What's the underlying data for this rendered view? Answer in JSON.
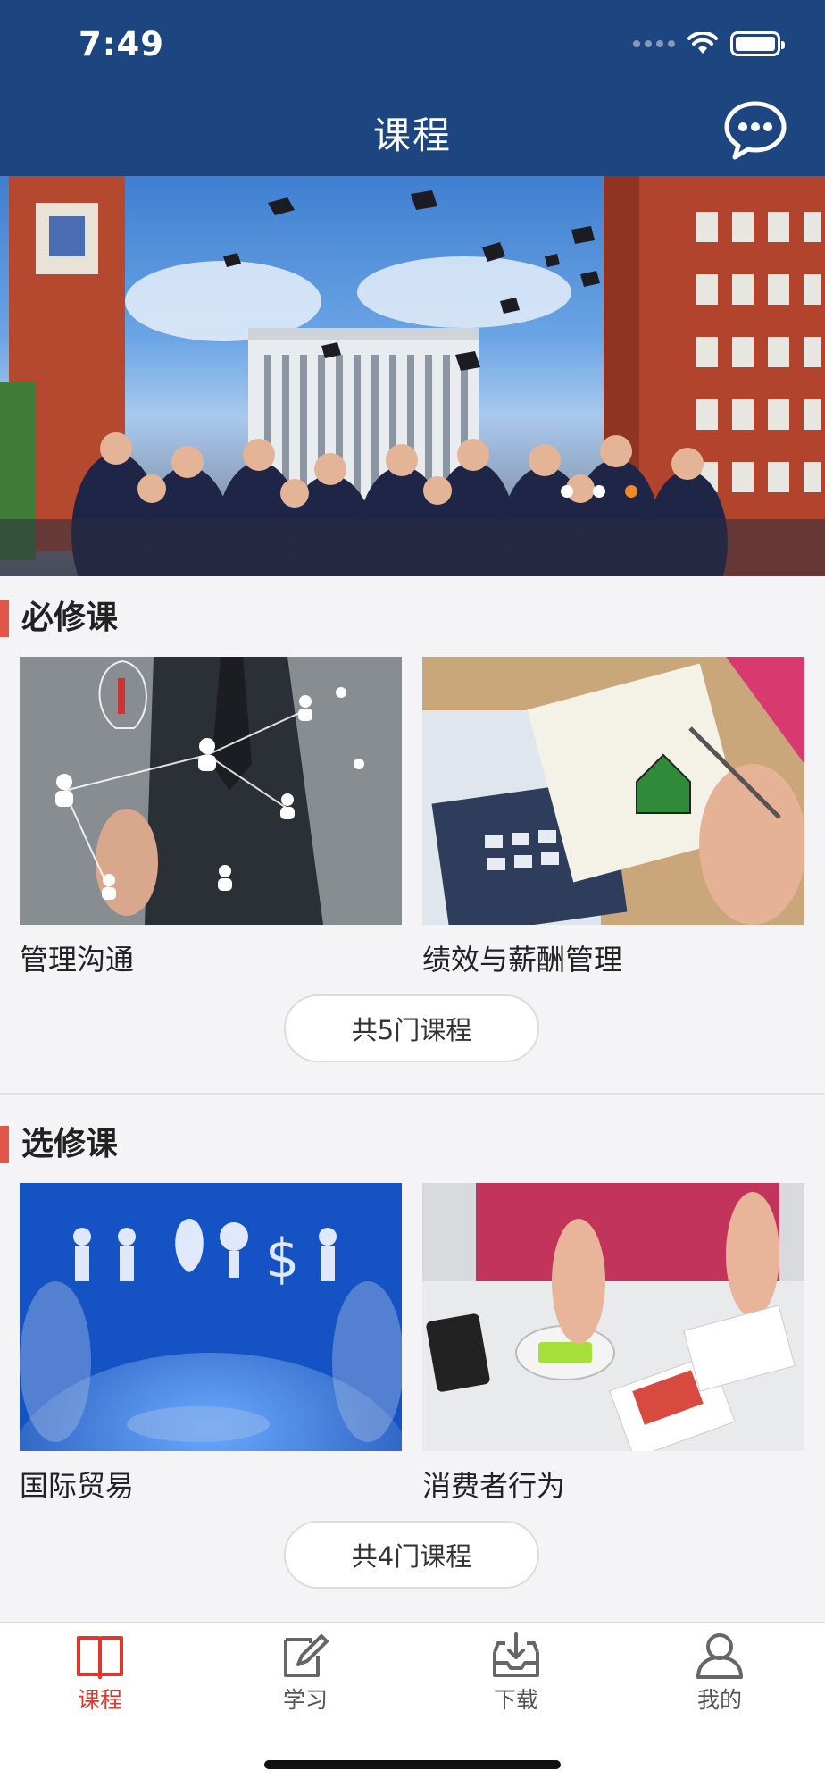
{
  "status_bar": {
    "time": "7:49"
  },
  "header": {
    "title": "课程",
    "chat_icon": "chat-bubble-icon"
  },
  "banner": {
    "dots": 3,
    "active_dot": 2
  },
  "required": {
    "title": "必修课",
    "courses": [
      {
        "name": "管理沟通"
      },
      {
        "name": "绩效与薪酬管理"
      }
    ],
    "more_label": "共5门课程"
  },
  "elective": {
    "title": "选修课",
    "courses": [
      {
        "name": "国际贸易"
      },
      {
        "name": "消费者行为"
      }
    ],
    "more_label": "共4门课程"
  },
  "tabs": [
    {
      "label": "课程",
      "icon": "book-icon",
      "active": true
    },
    {
      "label": "学习",
      "icon": "edit-icon",
      "active": false
    },
    {
      "label": "下载",
      "icon": "download-tray-icon",
      "active": false
    },
    {
      "label": "我的",
      "icon": "user-icon",
      "active": false
    }
  ],
  "colors": {
    "header_bg": "#1d4580",
    "accent_red": "#e3574a",
    "active_tab": "#e2352b",
    "banner_dot_active": "#f08a24"
  }
}
